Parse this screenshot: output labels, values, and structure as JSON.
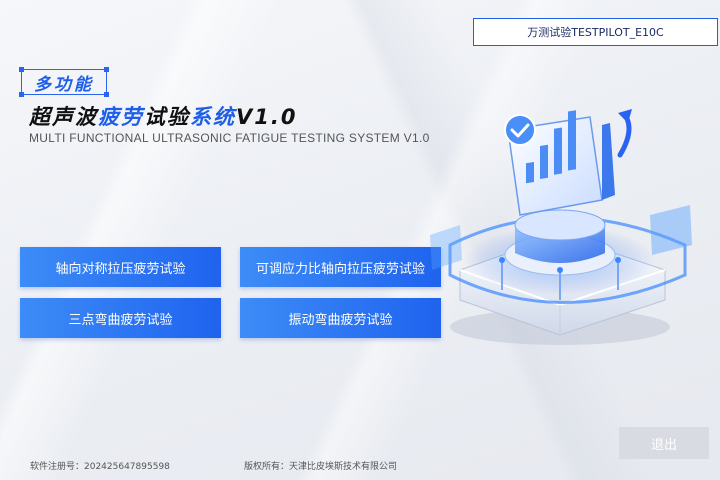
{
  "device_badge": "万测试验TESTPILOT_E10C",
  "tag": "多功能",
  "title": {
    "part1": "超声波",
    "part2": "疲劳",
    "part3": "试验",
    "part4": "系统",
    "part5": "V1.0"
  },
  "subtitle": "MULTI FUNCTIONAL ULTRASONIC FATIGUE TESTING SYSTEM V1.0",
  "buttons": {
    "axial_symmetric": "轴向对称拉压疲劳试验",
    "adjustable_ratio": "可调应力比轴向拉压疲劳试验",
    "three_point": "三点弯曲疲劳试验",
    "vibration_bending": "振动弯曲疲劳试验",
    "exit": "退出"
  },
  "footer": {
    "registration": "软件注册号：202425647895598",
    "copyright": "版权所有：天津比皮埃斯技术有限公司"
  },
  "colors": {
    "accent": "#1f5ee8",
    "button_start": "#3d8cf7",
    "button_end": "#1f63ee",
    "exit_bg": "#d8dbe1"
  },
  "icons": [
    "bar-chart-icon",
    "checkmark-icon",
    "platform-illustration"
  ]
}
